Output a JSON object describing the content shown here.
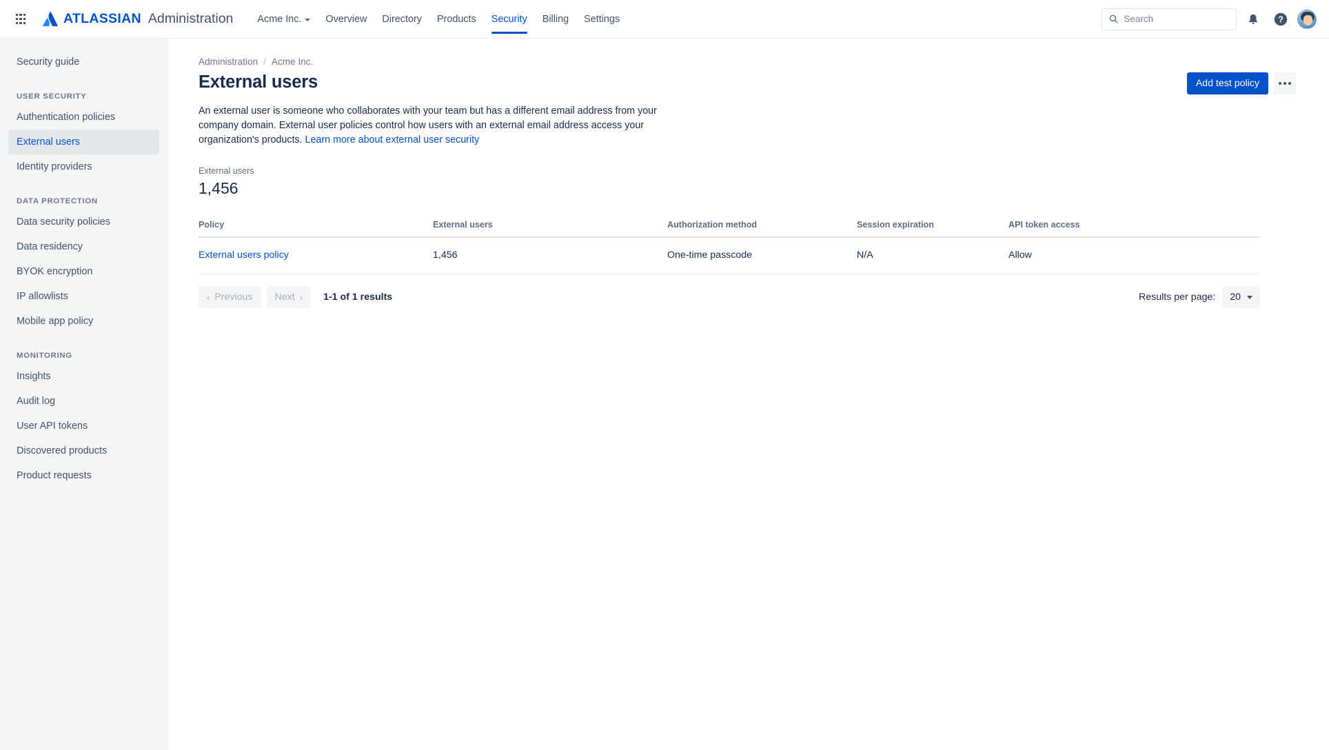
{
  "topnav": {
    "app_switcher": "app-switcher",
    "brand": {
      "atlassian": "ATLASSIAN",
      "product": "Administration"
    },
    "org_switcher": {
      "label": "Acme Inc."
    },
    "tabs": [
      {
        "label": "Overview",
        "active": false
      },
      {
        "label": "Directory",
        "active": false
      },
      {
        "label": "Products",
        "active": false
      },
      {
        "label": "Security",
        "active": true
      },
      {
        "label": "Billing",
        "active": false
      },
      {
        "label": "Settings",
        "active": false
      }
    ],
    "search": {
      "placeholder": "Search",
      "value": ""
    },
    "icons": {
      "notifications": "bell-icon",
      "help": "help-icon",
      "profile": "avatar"
    }
  },
  "sidebar": {
    "top_items": [
      {
        "label": "Security guide",
        "active": false
      }
    ],
    "sections": [
      {
        "heading": "USER SECURITY",
        "items": [
          {
            "label": "Authentication policies",
            "active": false
          },
          {
            "label": "External users",
            "active": true
          },
          {
            "label": "Identity providers",
            "active": false
          }
        ]
      },
      {
        "heading": "DATA PROTECTION",
        "items": [
          {
            "label": "Data security policies",
            "active": false
          },
          {
            "label": "Data residency",
            "active": false
          },
          {
            "label": "BYOK encryption",
            "active": false
          },
          {
            "label": "IP allowlists",
            "active": false
          },
          {
            "label": "Mobile app policy",
            "active": false
          }
        ]
      },
      {
        "heading": "MONITORING",
        "items": [
          {
            "label": "Insights",
            "active": false
          },
          {
            "label": "Audit log",
            "active": false
          },
          {
            "label": "User API tokens",
            "active": false
          },
          {
            "label": "Discovered products",
            "active": false
          },
          {
            "label": "Product requests",
            "active": false
          }
        ]
      }
    ]
  },
  "main": {
    "breadcrumb": {
      "root": "Administration",
      "separator": "/",
      "org": "Acme Inc."
    },
    "page_title": "External users",
    "actions": {
      "primary": "Add test policy",
      "more": "more-actions"
    },
    "description": {
      "text": "An external user is someone who collaborates with your team but has a different email address from your company domain. External user policies control how users with an external email address access your organization's products. ",
      "link": "Learn more about external user security"
    },
    "metric": {
      "label": "External users",
      "value": "1,456"
    },
    "table": {
      "columns": [
        "Policy",
        "External users",
        "Authorization method",
        "Session expiration",
        "API token access"
      ],
      "rows": [
        {
          "policy": "External users policy",
          "external_users": "1,456",
          "authorization_method": "One-time passcode",
          "session_expiration": "N/A",
          "api_token_access": "Allow"
        }
      ]
    },
    "pagination": {
      "previous": "Previous",
      "next": "Next",
      "prev_arrow": "‹",
      "next_arrow": "›",
      "results": "1-1 of 1 results",
      "per_page_label": "Results per page:",
      "per_page_value": "20"
    }
  },
  "colors": {
    "brand_blue": "#0052cc",
    "link_blue": "#0052cc",
    "text_primary": "#172b4d",
    "text_subtle": "#5e6c84",
    "sidebar_bg": "#f4f5f7"
  }
}
